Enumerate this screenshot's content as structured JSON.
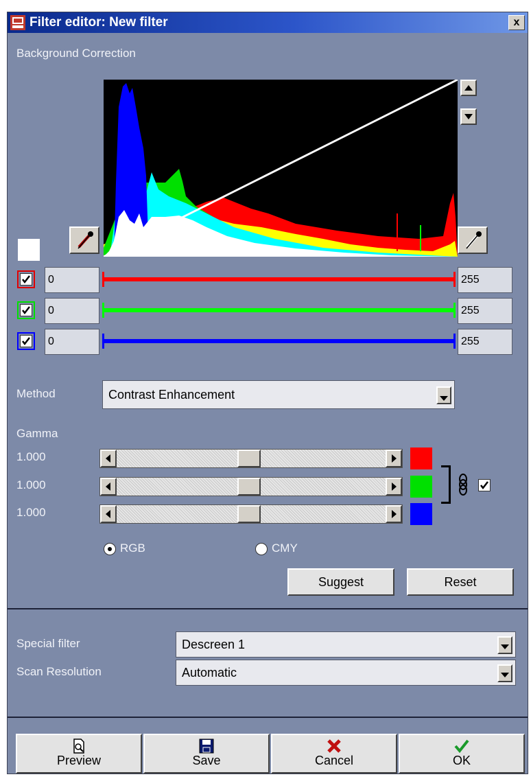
{
  "window": {
    "title": "Filter editor: New filter",
    "close_label": "x"
  },
  "background_correction": {
    "heading": "Background Correction",
    "channels": [
      {
        "color": "#ff0000",
        "enabled": true,
        "min": "0",
        "max": "255"
      },
      {
        "color": "#00ff00",
        "enabled": true,
        "min": "0",
        "max": "255"
      },
      {
        "color": "#0000ff",
        "enabled": true,
        "min": "0",
        "max": "255"
      }
    ]
  },
  "method": {
    "label": "Method",
    "value": "Contrast Enhancement"
  },
  "gamma": {
    "label": "Gamma",
    "values": [
      "1.000",
      "1.000",
      "1.000"
    ],
    "swatches": [
      "#ff0000",
      "#00ff00",
      "#0000ff"
    ],
    "linked": true
  },
  "color_mode": {
    "rgb_label": "RGB",
    "cmy_label": "CMY",
    "selected": "RGB"
  },
  "actions": {
    "suggest": "Suggest",
    "reset": "Reset"
  },
  "special_filter": {
    "label": "Special filter",
    "value": "Descreen 1"
  },
  "scan_resolution": {
    "label": "Scan Resolution",
    "value": "Automatic"
  },
  "footer": {
    "preview": "Preview",
    "save": "Save",
    "cancel": "Cancel",
    "ok": "OK"
  }
}
